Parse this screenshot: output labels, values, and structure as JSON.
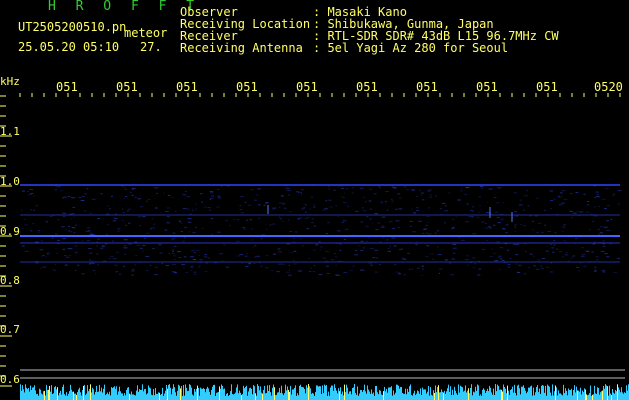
{
  "app": {
    "title": "H R O F F T",
    "filename": "UT2505200510.pn",
    "mode": "meteor",
    "datetime": "25.05.20 05:10",
    "count": "27."
  },
  "info": {
    "labels": [
      "Observer",
      "Receiving Location",
      "Receiver",
      "Receiving Antenna"
    ],
    "values": [
      ": Masaki Kano",
      ": Shibukawa, Gunma, Japan",
      ": RTL-SDR SDR# 43dB L15 96.7MHz CW",
      ": 5el Yagi Az 280 for Seoul"
    ]
  },
  "axis": {
    "unit": "kHz",
    "y_ticks": [
      "1.1",
      "1.0",
      "0.9",
      "0.8",
      "0.7",
      "0.6"
    ],
    "x_ticks": [
      "051",
      "051",
      "051",
      "051",
      "051",
      "051",
      "051",
      "051",
      "051",
      "0520"
    ]
  },
  "colors": {
    "background": "#000000",
    "label": "#ffff66",
    "title": "#33cc33",
    "signal": "#3344ff",
    "noise": "#33ccff"
  }
}
